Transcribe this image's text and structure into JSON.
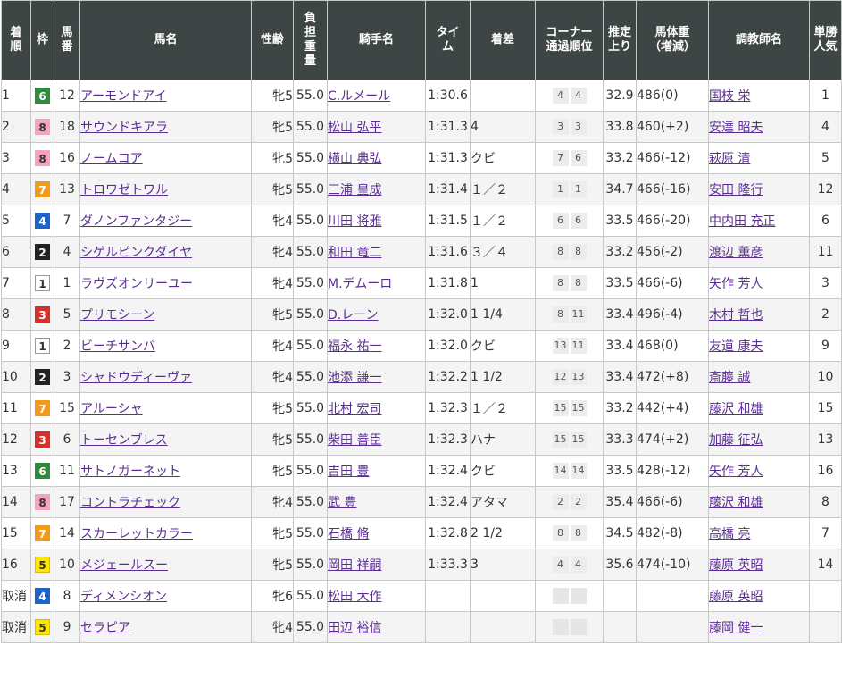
{
  "table": {
    "headers": {
      "rank": "着順",
      "frame": "枠",
      "number": "馬番",
      "horse": "馬名",
      "sex_age": "性齢",
      "weight": "負担重量",
      "jockey": "騎手名",
      "time": "タイム",
      "margin": "着差",
      "corner_line1": "コーナー",
      "corner_line2": "通過順位",
      "last3f": "推定上り",
      "body_line1": "馬体重",
      "body_line2": "（増減）",
      "trainer": "調教師名",
      "popularity": "単勝人気"
    },
    "rows": [
      {
        "rank": "1",
        "frame": "6",
        "number": "12",
        "horse": "アーモンドアイ",
        "sex_age": "牝5",
        "weight": "55.0",
        "jockey": "C.ルメール",
        "time": "1:30.6",
        "margin": "",
        "corner": [
          "4",
          "4"
        ],
        "last3f": "32.9",
        "body": "486(0)",
        "trainer": "国枝 栄",
        "popularity": "1"
      },
      {
        "rank": "2",
        "frame": "8",
        "number": "18",
        "horse": "サウンドキアラ",
        "sex_age": "牝5",
        "weight": "55.0",
        "jockey": "松山 弘平",
        "time": "1:31.3",
        "margin": "4",
        "corner": [
          "3",
          "3"
        ],
        "last3f": "33.8",
        "body": "460(+2)",
        "trainer": "安達 昭夫",
        "popularity": "4"
      },
      {
        "rank": "3",
        "frame": "8",
        "number": "16",
        "horse": "ノームコア",
        "sex_age": "牝5",
        "weight": "55.0",
        "jockey": "横山 典弘",
        "time": "1:31.3",
        "margin": "クビ",
        "corner": [
          "7",
          "6"
        ],
        "last3f": "33.2",
        "body": "466(-12)",
        "trainer": "萩原 清",
        "popularity": "5"
      },
      {
        "rank": "4",
        "frame": "7",
        "number": "13",
        "horse": "トロワゼトワル",
        "sex_age": "牝5",
        "weight": "55.0",
        "jockey": "三浦 皇成",
        "time": "1:31.4",
        "margin": "１／２",
        "corner": [
          "1",
          "1"
        ],
        "last3f": "34.7",
        "body": "466(-16)",
        "trainer": "安田 隆行",
        "popularity": "12"
      },
      {
        "rank": "5",
        "frame": "4",
        "number": "7",
        "horse": "ダノンファンタジー",
        "sex_age": "牝4",
        "weight": "55.0",
        "jockey": "川田 将雅",
        "time": "1:31.5",
        "margin": "１／２",
        "corner": [
          "6",
          "6"
        ],
        "last3f": "33.5",
        "body": "466(-20)",
        "trainer": "中内田 充正",
        "popularity": "6"
      },
      {
        "rank": "6",
        "frame": "2",
        "number": "4",
        "horse": "シゲルピンクダイヤ",
        "sex_age": "牝4",
        "weight": "55.0",
        "jockey": "和田 竜二",
        "time": "1:31.6",
        "margin": "３／４",
        "corner": [
          "8",
          "8"
        ],
        "last3f": "33.2",
        "body": "456(-2)",
        "trainer": "渡辺 薫彦",
        "popularity": "11"
      },
      {
        "rank": "7",
        "frame": "1",
        "number": "1",
        "horse": "ラヴズオンリーユー",
        "sex_age": "牝4",
        "weight": "55.0",
        "jockey": "M.デムーロ",
        "time": "1:31.8",
        "margin": "1",
        "corner": [
          "8",
          "8"
        ],
        "last3f": "33.5",
        "body": "466(-6)",
        "trainer": "矢作 芳人",
        "popularity": "3"
      },
      {
        "rank": "8",
        "frame": "3",
        "number": "5",
        "horse": "プリモシーン",
        "sex_age": "牝5",
        "weight": "55.0",
        "jockey": "D.レーン",
        "time": "1:32.0",
        "margin": "1 1/4",
        "corner": [
          "8",
          "11"
        ],
        "last3f": "33.4",
        "body": "496(-4)",
        "trainer": "木村 哲也",
        "popularity": "2"
      },
      {
        "rank": "9",
        "frame": "1",
        "number": "2",
        "horse": "ビーチサンバ",
        "sex_age": "牝4",
        "weight": "55.0",
        "jockey": "福永 祐一",
        "time": "1:32.0",
        "margin": "クビ",
        "corner": [
          "13",
          "11"
        ],
        "last3f": "33.4",
        "body": "468(0)",
        "trainer": "友道 康夫",
        "popularity": "9"
      },
      {
        "rank": "10",
        "frame": "2",
        "number": "3",
        "horse": "シャドウディーヴァ",
        "sex_age": "牝4",
        "weight": "55.0",
        "jockey": "池添 謙一",
        "time": "1:32.2",
        "margin": "1 1/2",
        "corner": [
          "12",
          "13"
        ],
        "last3f": "33.4",
        "body": "472(+8)",
        "trainer": "斎藤 誠",
        "popularity": "10"
      },
      {
        "rank": "11",
        "frame": "7",
        "number": "15",
        "horse": "アルーシャ",
        "sex_age": "牝5",
        "weight": "55.0",
        "jockey": "北村 宏司",
        "time": "1:32.3",
        "margin": "１／２",
        "corner": [
          "15",
          "15"
        ],
        "last3f": "33.2",
        "body": "442(+4)",
        "trainer": "藤沢 和雄",
        "popularity": "15"
      },
      {
        "rank": "12",
        "frame": "3",
        "number": "6",
        "horse": "トーセンブレス",
        "sex_age": "牝5",
        "weight": "55.0",
        "jockey": "柴田 善臣",
        "time": "1:32.3",
        "margin": "ハナ",
        "corner": [
          "15",
          "15"
        ],
        "last3f": "33.3",
        "body": "474(+2)",
        "trainer": "加藤 征弘",
        "popularity": "13"
      },
      {
        "rank": "13",
        "frame": "6",
        "number": "11",
        "horse": "サトノガーネット",
        "sex_age": "牝5",
        "weight": "55.0",
        "jockey": "吉田 豊",
        "time": "1:32.4",
        "margin": "クビ",
        "corner": [
          "14",
          "14"
        ],
        "last3f": "33.5",
        "body": "428(-12)",
        "trainer": "矢作 芳人",
        "popularity": "16"
      },
      {
        "rank": "14",
        "frame": "8",
        "number": "17",
        "horse": "コントラチェック",
        "sex_age": "牝4",
        "weight": "55.0",
        "jockey": "武 豊",
        "time": "1:32.4",
        "margin": "アタマ",
        "corner": [
          "2",
          "2"
        ],
        "last3f": "35.4",
        "body": "466(-6)",
        "trainer": "藤沢 和雄",
        "popularity": "8"
      },
      {
        "rank": "15",
        "frame": "7",
        "number": "14",
        "horse": "スカーレットカラー",
        "sex_age": "牝5",
        "weight": "55.0",
        "jockey": "石橋 脩",
        "time": "1:32.8",
        "margin": "2 1/2",
        "corner": [
          "8",
          "8"
        ],
        "last3f": "34.5",
        "body": "482(-8)",
        "trainer": "高橋 亮",
        "popularity": "7"
      },
      {
        "rank": "16",
        "frame": "5",
        "number": "10",
        "horse": "メジェールスー",
        "sex_age": "牝5",
        "weight": "55.0",
        "jockey": "岡田 祥嗣",
        "time": "1:33.3",
        "margin": "3",
        "corner": [
          "4",
          "4"
        ],
        "last3f": "35.6",
        "body": "474(-10)",
        "trainer": "藤原 英昭",
        "popularity": "14"
      },
      {
        "rank": "取消",
        "frame": "4",
        "number": "8",
        "horse": "ディメンシオン",
        "sex_age": "牝6",
        "weight": "55.0",
        "jockey": "松田 大作",
        "time": "",
        "margin": "",
        "corner": [
          "",
          ""
        ],
        "last3f": "",
        "body": "",
        "trainer": "藤原 英昭",
        "popularity": ""
      },
      {
        "rank": "取消",
        "frame": "5",
        "number": "9",
        "horse": "セラピア",
        "sex_age": "牝4",
        "weight": "55.0",
        "jockey": "田辺 裕信",
        "time": "",
        "margin": "",
        "corner": [
          "",
          ""
        ],
        "last3f": "",
        "body": "",
        "trainer": "藤岡 健一",
        "popularity": ""
      }
    ]
  },
  "frame_colors": {
    "1": {
      "bg": "#ffffff",
      "fg": "#333333",
      "border": "#999999"
    },
    "2": {
      "bg": "#222222",
      "fg": "#ffffff",
      "border": "#222222"
    },
    "3": {
      "bg": "#d7302a",
      "fg": "#ffffff",
      "border": "#d7302a"
    },
    "4": {
      "bg": "#1e63c9",
      "fg": "#ffffff",
      "border": "#1e63c9"
    },
    "5": {
      "bg": "#ffe500",
      "fg": "#333333",
      "border": "#d4bf00"
    },
    "6": {
      "bg": "#2f8a3b",
      "fg": "#ffffff",
      "border": "#2f8a3b"
    },
    "7": {
      "bg": "#f39a1e",
      "fg": "#ffffff",
      "border": "#f39a1e"
    },
    "8": {
      "bg": "#f6a3bd",
      "fg": "#333333",
      "border": "#f6a3bd"
    }
  },
  "colors": {
    "header_bg": "#3d4545",
    "link": "#5a2d91",
    "row_alt": "#f4f4f4",
    "grid": "#c8c8c8"
  }
}
